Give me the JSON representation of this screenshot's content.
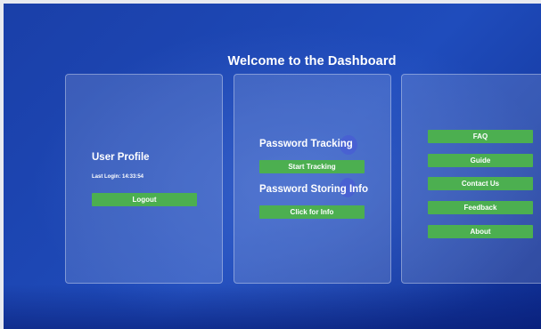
{
  "page": {
    "title": "Welcome to the Dashboard"
  },
  "user_card": {
    "heading": "User Profile",
    "last_login": "Last Login: 14:33:54",
    "logout_label": "Logout"
  },
  "password_card": {
    "tracking_heading": "Password Tracking",
    "start_tracking_label": "Start Tracking",
    "storing_heading": "Password Storing Info",
    "info_label": "Click for Info"
  },
  "links_card": {
    "items": [
      {
        "label": "FAQ"
      },
      {
        "label": "Guide"
      },
      {
        "label": "Contact Us"
      },
      {
        "label": "Feedback"
      },
      {
        "label": "About"
      }
    ]
  },
  "colors": {
    "accent_button": "#4caf50",
    "background": "#1d47b4",
    "text": "#ffffff"
  }
}
